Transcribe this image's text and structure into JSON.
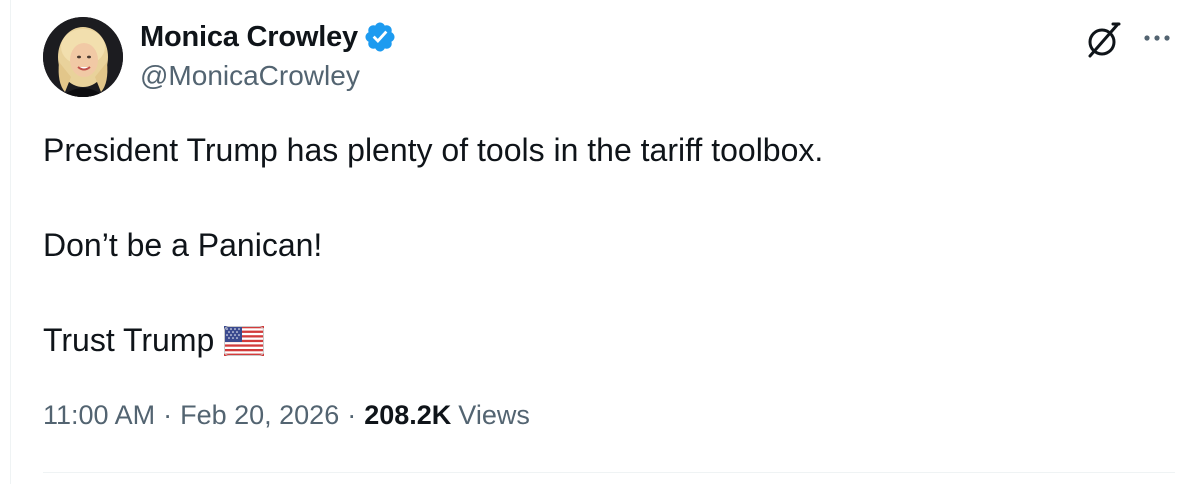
{
  "author": {
    "name": "Monica Crowley",
    "handle": "@MonicaCrowley",
    "verified": true
  },
  "tweet": {
    "lines": [
      "President Trump has plenty of tools in the tariff toolbox.",
      "Don’t be a Panican!",
      "Trust Trump"
    ],
    "emoji": "us-flag-emoji"
  },
  "meta": {
    "time": "11:00 AM",
    "separator": "·",
    "date": "Feb 20, 2026",
    "views_count": "208.2K",
    "views_label": "Views"
  },
  "icons": {
    "verified": "verified-badge-icon",
    "grok": "grok-icon",
    "more": "more-icon"
  },
  "colors": {
    "text_primary": "#0f1419",
    "text_secondary": "#536471",
    "verified_blue": "#1d9bf0",
    "divider": "#eff3f4"
  }
}
